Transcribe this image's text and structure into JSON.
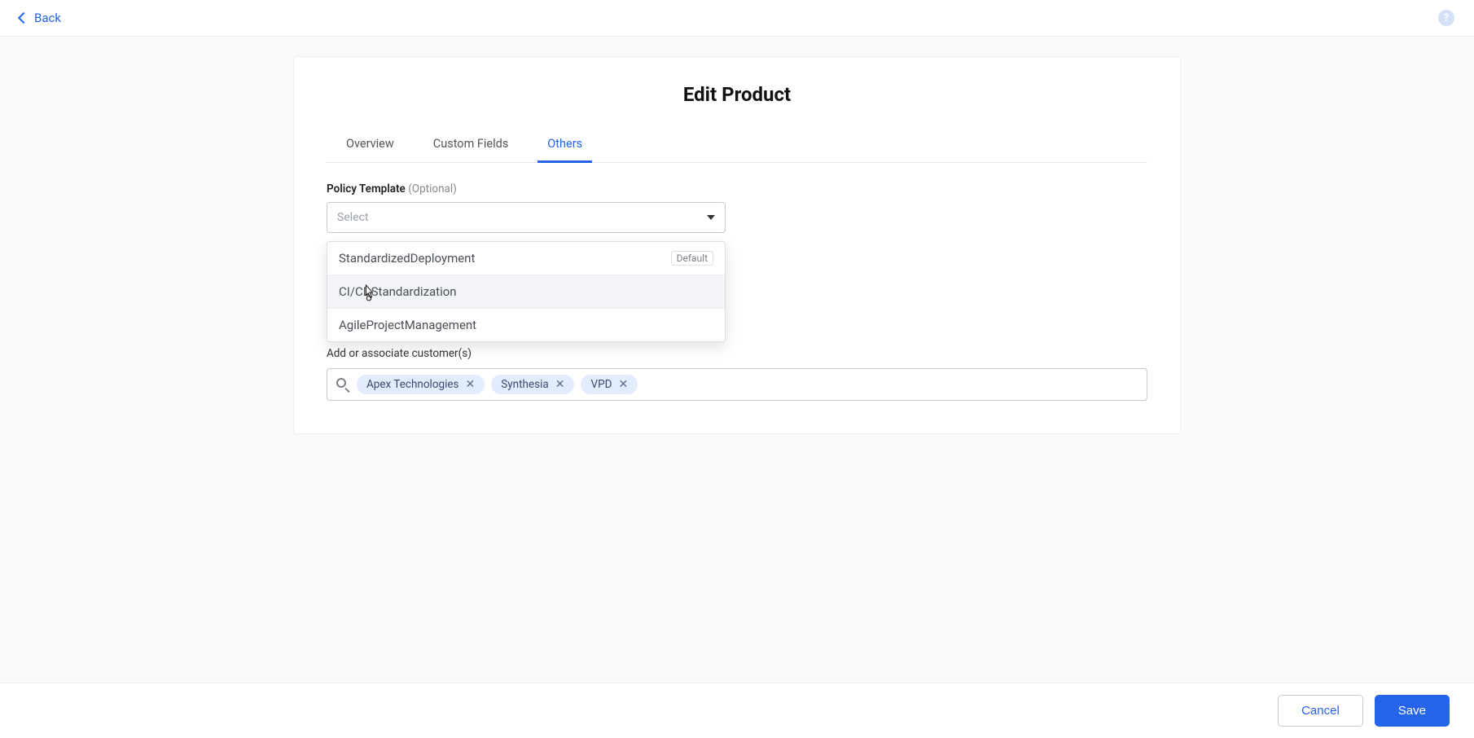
{
  "header": {
    "back_label": "Back"
  },
  "page": {
    "title": "Edit Product"
  },
  "tabs": [
    {
      "label": "Overview",
      "active": false
    },
    {
      "label": "Custom Fields",
      "active": false
    },
    {
      "label": "Others",
      "active": true
    }
  ],
  "policy": {
    "label": "Policy Template",
    "optional": "(Optional)",
    "placeholder": "Select",
    "options": [
      {
        "label": "StandardizedDeployment",
        "default_badge": "Default"
      },
      {
        "label": "CI/CDStandardization"
      },
      {
        "label": "AgileProjectManagement"
      }
    ]
  },
  "customers": {
    "label": "Add or associate customer(s)",
    "chips": [
      {
        "label": "Apex Technologies"
      },
      {
        "label": "Synthesia"
      },
      {
        "label": "VPD"
      }
    ]
  },
  "footer": {
    "cancel": "Cancel",
    "save": "Save"
  }
}
